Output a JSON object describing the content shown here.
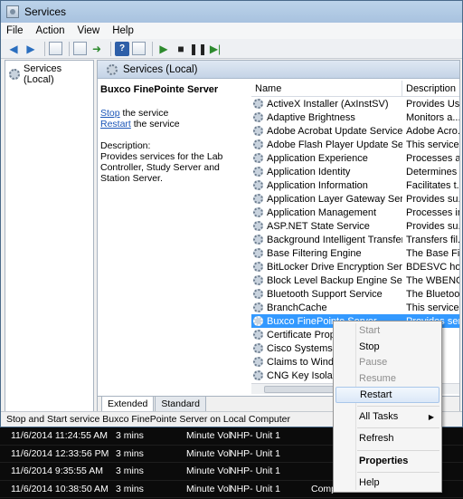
{
  "window": {
    "title": "Services"
  },
  "menu": [
    "File",
    "Action",
    "View",
    "Help"
  ],
  "toolbar": {
    "icons": [
      "back-arrow-icon",
      "forward-arrow-icon",
      "console-tree-icon",
      "properties-icon",
      "export-icon",
      "help-icon",
      "play-icon",
      "stop-icon",
      "pause-icon",
      "restart-icon"
    ]
  },
  "tree": {
    "root_label": "Services (Local)"
  },
  "pane": {
    "header": "Services (Local)",
    "selected_service": "Buxco FinePointe Server",
    "stop_link": "Stop",
    "stop_suffix": " the service",
    "restart_link": "Restart",
    "restart_suffix": " the service",
    "description_label": "Description:",
    "description_text": "Provides services for the Lab Controller, Study Server and Station Server."
  },
  "list": {
    "col_name": "Name",
    "col_desc": "Description",
    "rows": [
      {
        "name": "ActiveX Installer (AxInstSV)",
        "desc": "Provides Us..."
      },
      {
        "name": "Adaptive Brightness",
        "desc": "Monitors a..."
      },
      {
        "name": "Adobe Acrobat Update Service",
        "desc": "Adobe Acro..."
      },
      {
        "name": "Adobe Flash Player Update Service",
        "desc": "This service ..."
      },
      {
        "name": "Application Experience",
        "desc": "Processes a..."
      },
      {
        "name": "Application Identity",
        "desc": "Determines ..."
      },
      {
        "name": "Application Information",
        "desc": "Facilitates t..."
      },
      {
        "name": "Application Layer Gateway Service",
        "desc": "Provides su..."
      },
      {
        "name": "Application Management",
        "desc": "Processes in..."
      },
      {
        "name": "ASP.NET State Service",
        "desc": "Provides su..."
      },
      {
        "name": "Background Intelligent Transfer S...",
        "desc": "Transfers fil..."
      },
      {
        "name": "Base Filtering Engine",
        "desc": "The Base Fil..."
      },
      {
        "name": "BitLocker Drive Encryption Service",
        "desc": "BDESVC hos..."
      },
      {
        "name": "Block Level Backup Engine Service",
        "desc": "The WBENG..."
      },
      {
        "name": "Bluetooth Support Service",
        "desc": "The Bluetoo..."
      },
      {
        "name": "BranchCache",
        "desc": "This service ..."
      },
      {
        "name": "Buxco FinePointe Server",
        "desc": "Provides ser..."
      },
      {
        "name": "Certificate Propaga",
        "desc": "...ser..."
      },
      {
        "name": "Cisco Systems, Inc",
        "desc": "...ss..."
      },
      {
        "name": "Claims to Window",
        "desc": "...o..."
      },
      {
        "name": "CNG Key Isolation",
        "desc": "...is..."
      }
    ]
  },
  "tabs": [
    "Extended",
    "Standard"
  ],
  "status": "Stop and Start service Buxco FinePointe Server on Local Computer",
  "context_menu": [
    {
      "label": "Start",
      "disabled": true
    },
    {
      "label": "Stop"
    },
    {
      "label": "Pause",
      "disabled": true
    },
    {
      "label": "Resume",
      "disabled": true
    },
    {
      "label": "Restart",
      "highlighted": true
    },
    {
      "label": "All Tasks",
      "submenu": true
    },
    {
      "label": "Refresh"
    },
    {
      "label": "Properties",
      "bold": true
    },
    {
      "label": "Help"
    }
  ],
  "background_table": [
    {
      "date": "11/6/2014 11:24:55 AM",
      "dur": "3 mins",
      "type": "Minute Vol",
      "unit": "NHP- Unit 1",
      "status": ""
    },
    {
      "date": "11/6/2014 12:33:56 PM",
      "dur": "3 mins",
      "type": "Minute Vol",
      "unit": "NHP- Unit 1",
      "status": ""
    },
    {
      "date": "11/6/2014 9:35:55 AM",
      "dur": "3 mins",
      "type": "Minute Vol",
      "unit": "NHP- Unit 1",
      "status": ""
    },
    {
      "date": "11/6/2014 10:38:50 AM",
      "dur": "3 mins",
      "type": "Minute Vol",
      "unit": "NHP- Unit 1",
      "status": "Complete"
    }
  ]
}
